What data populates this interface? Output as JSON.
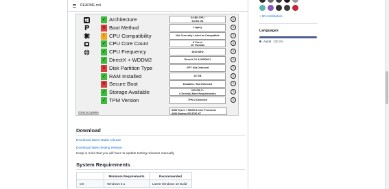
{
  "readme": {
    "filename": "README.md"
  },
  "checker": {
    "rows": [
      {
        "icon": "windows-logo-icon",
        "status": "ok",
        "mark": "✓",
        "label": "Architecture",
        "value": [
          "64 Bit CPU",
          "64 Bit OS"
        ]
      },
      {
        "icon": "boot-p-icon",
        "status": "bad",
        "mark": "✕",
        "label": "Boot Method",
        "value": [
          "Legacy"
        ]
      },
      {
        "icon": "cpu-chip-icon",
        "status": "warn",
        "mark": "!",
        "label": "CPU Compatibility",
        "value": [
          "Not Currently Listed as Compatible"
        ]
      },
      {
        "icon": "core-icon",
        "status": "ok",
        "mark": "✓",
        "label": "CPU Core Count",
        "value": [
          "8 Cores",
          "16 Threads"
        ]
      },
      {
        "icon": "globe-icon",
        "status": "ok",
        "mark": "✓",
        "label": "CPU Frequency",
        "value": [
          "3600 MHz"
        ]
      },
      {
        "icon": "",
        "status": "ok",
        "mark": "✓",
        "label": "DirectX + WDDM2",
        "value": [
          "DirectX 12 & WDDM 2"
        ]
      },
      {
        "icon": "",
        "status": "bad",
        "mark": "✕",
        "label": "Disk Partition Type",
        "value": [
          "GPT Not Detected"
        ]
      },
      {
        "icon": "",
        "status": "ok",
        "mark": "✓",
        "label": "RAM Installed",
        "value": [
          "32 GB"
        ]
      },
      {
        "icon": "",
        "status": "bad",
        "mark": "✕",
        "label": "Secure Boot",
        "value": [
          "Disabled / Not Detected"
        ]
      },
      {
        "icon": "",
        "status": "ok",
        "mark": "✓",
        "label": "Storage Available",
        "value": [
          "195 GB C:",
          "6 Drive(s) Meet Requirements"
        ]
      },
      {
        "icon": "",
        "status": "ok",
        "mark": "✓",
        "label": "TPM Version",
        "value": [
          "TPM 2 Detected"
        ]
      }
    ],
    "info_glyph": "i",
    "check_updates": "Check for Updates",
    "cpu_name": "AMD Ryzen 7 5800X 8-Core Processor",
    "gpu_name": "AMD Radeon RX 5700 XT",
    "colors": {
      "ok": "#3dbb3d",
      "bad": "#e33b3b",
      "warn": "#f5a623"
    }
  },
  "download": {
    "heading": "Download",
    "stable_link": "Download latest stable release",
    "testing_link": "Download latest testing release",
    "note": "Keep in mind that you will have to update testing releases manually"
  },
  "requirements": {
    "heading": "System Requirements",
    "columns": [
      "",
      "Minimum Requirements",
      "Recommended"
    ],
    "rows": [
      [
        "OS",
        "Windows 8.1",
        "Latest Windows 10 Build"
      ]
    ]
  },
  "sidebar": {
    "contributors_link": "+ 80 contributors",
    "languages_heading": "Languages",
    "languages": [
      {
        "name": "AutoIt",
        "percent": "100.0%",
        "color": "#4f5d95"
      }
    ]
  }
}
